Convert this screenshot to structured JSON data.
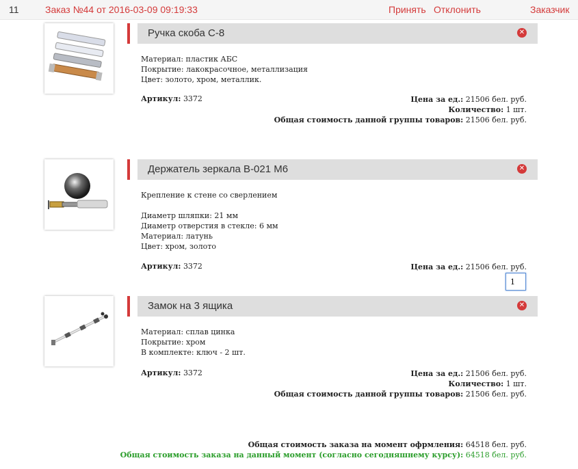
{
  "header": {
    "number": "11",
    "title": "Заказ №44 от 2016-03-09 09:19:33",
    "accept_label": "Принять",
    "decline_label": "Отклонить",
    "customer_label": "Заказчик"
  },
  "labels": {
    "article": "Артикул:",
    "price": "Цена за ед.:",
    "quantity": "Количество:",
    "group_total": "Общая стоимость данной группы товаров:"
  },
  "items": [
    {
      "name": "Ручка скоба С-8",
      "desc": [
        "Материал: пластик АБС",
        "Покрытие: лакокрасочное, металлизация",
        "Цвет: золото, хром, металлик."
      ],
      "article": "3372",
      "price": "21506 бел. руб.",
      "quantity": "1 шт.",
      "group_total": "21506 бел. руб."
    },
    {
      "name": "Держатель зеркала В-021 М6",
      "desc": [
        "Крепление к стене со сверлением",
        "",
        "Диаметр шляпки: 21 мм",
        "Диаметр отверстия в стекле: 6 мм",
        "Материал: латунь",
        "Цвет: хром, золото"
      ],
      "article": "3372",
      "price": "21506 бел. руб.",
      "quantity_input": "1"
    },
    {
      "name": "Замок на 3 ящика",
      "desc": [
        "Материал: сплав цинка",
        "Покрытие: хром",
        "В комплекте: ключ - 2 шт."
      ],
      "article": "3372",
      "price": "21506 бел. руб.",
      "quantity": "1 шт.",
      "group_total": "21506 бел. руб."
    }
  ],
  "totals": {
    "at_order_label": "Общая стоимость заказа на момент офрмления:",
    "at_order_value": "64518 бел. руб.",
    "current_label": "Общая стоимость заказа на данный момент (согласно сегодняшнему курсу):",
    "current_value": "64518 бел. руб."
  },
  "colors": {
    "accent": "#d43a3a",
    "green": "#2a9d2a",
    "header_bg": "#dedede"
  },
  "icons": {
    "remove": "close-circle-icon"
  }
}
